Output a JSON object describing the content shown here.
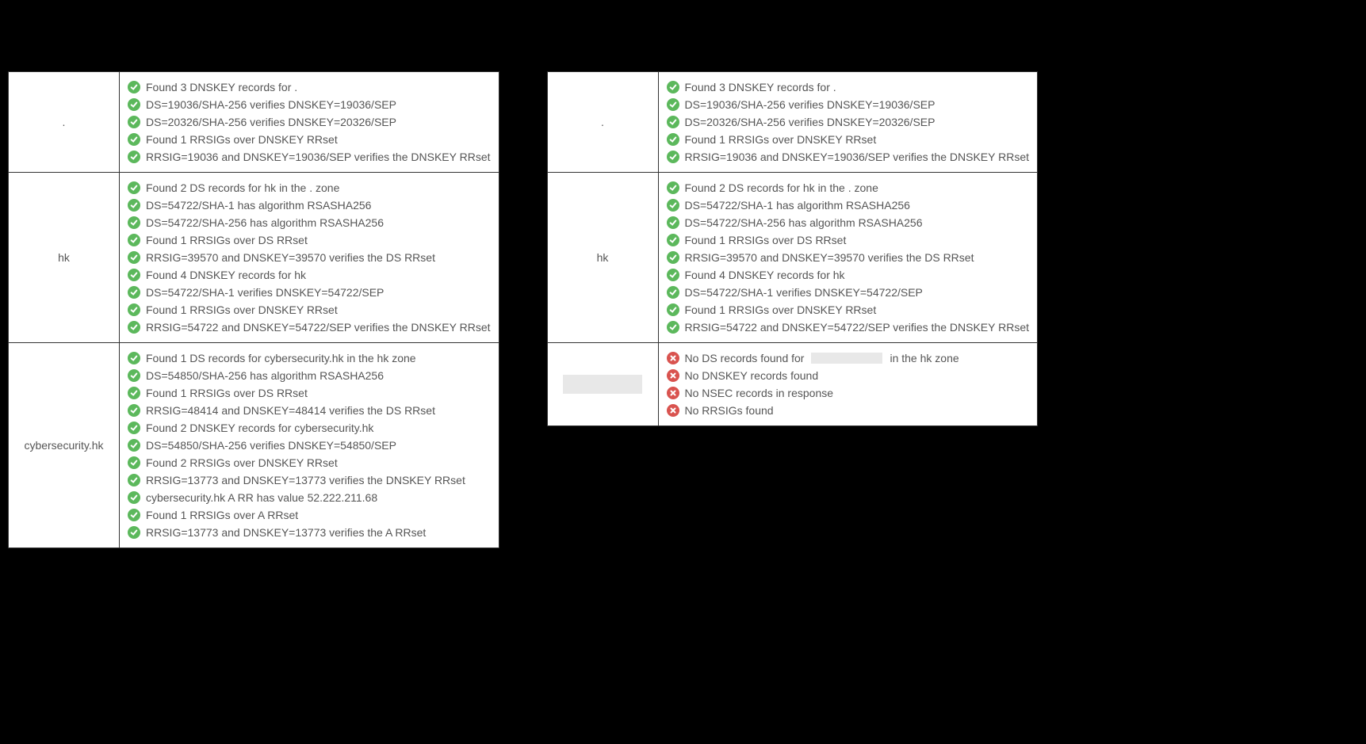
{
  "left": [
    {
      "zone": ".",
      "items": [
        {
          "status": "ok",
          "text": "Found 3 DNSKEY records for ."
        },
        {
          "status": "ok",
          "text": "DS=19036/SHA-256 verifies DNSKEY=19036/SEP"
        },
        {
          "status": "ok",
          "text": "DS=20326/SHA-256 verifies DNSKEY=20326/SEP"
        },
        {
          "status": "ok",
          "text": "Found 1 RRSIGs over DNSKEY RRset"
        },
        {
          "status": "ok",
          "text": "RRSIG=19036 and DNSKEY=19036/SEP verifies the DNSKEY RRset"
        }
      ]
    },
    {
      "zone": "hk",
      "items": [
        {
          "status": "ok",
          "text": "Found 2 DS records for hk in the . zone"
        },
        {
          "status": "ok",
          "text": "DS=54722/SHA-1 has algorithm RSASHA256"
        },
        {
          "status": "ok",
          "text": "DS=54722/SHA-256 has algorithm RSASHA256"
        },
        {
          "status": "ok",
          "text": "Found 1 RRSIGs over DS RRset"
        },
        {
          "status": "ok",
          "text": "RRSIG=39570 and DNSKEY=39570 verifies the DS RRset"
        },
        {
          "status": "ok",
          "text": "Found 4 DNSKEY records for hk"
        },
        {
          "status": "ok",
          "text": "DS=54722/SHA-1 verifies DNSKEY=54722/SEP"
        },
        {
          "status": "ok",
          "text": "Found 1 RRSIGs over DNSKEY RRset"
        },
        {
          "status": "ok",
          "text": "RRSIG=54722 and DNSKEY=54722/SEP verifies the DNSKEY RRset"
        }
      ]
    },
    {
      "zone": "cybersecurity.hk",
      "items": [
        {
          "status": "ok",
          "text": "Found 1 DS records for cybersecurity.hk in the hk zone"
        },
        {
          "status": "ok",
          "text": "DS=54850/SHA-256 has algorithm RSASHA256"
        },
        {
          "status": "ok",
          "text": "Found 1 RRSIGs over DS RRset"
        },
        {
          "status": "ok",
          "text": "RRSIG=48414 and DNSKEY=48414 verifies the DS RRset"
        },
        {
          "status": "ok",
          "text": "Found 2 DNSKEY records for cybersecurity.hk"
        },
        {
          "status": "ok",
          "text": "DS=54850/SHA-256 verifies DNSKEY=54850/SEP"
        },
        {
          "status": "ok",
          "text": "Found 2 RRSIGs over DNSKEY RRset"
        },
        {
          "status": "ok",
          "text": "RRSIG=13773 and DNSKEY=13773 verifies the DNSKEY RRset"
        },
        {
          "status": "ok",
          "text": "cybersecurity.hk A RR has value 52.222.211.68"
        },
        {
          "status": "ok",
          "text": "Found 1 RRSIGs over A RRset"
        },
        {
          "status": "ok",
          "text": "RRSIG=13773 and DNSKEY=13773 verifies the A RRset"
        }
      ]
    }
  ],
  "right": [
    {
      "zone": ".",
      "items": [
        {
          "status": "ok",
          "text": "Found 3 DNSKEY records for ."
        },
        {
          "status": "ok",
          "text": "DS=19036/SHA-256 verifies DNSKEY=19036/SEP"
        },
        {
          "status": "ok",
          "text": "DS=20326/SHA-256 verifies DNSKEY=20326/SEP"
        },
        {
          "status": "ok",
          "text": "Found 1 RRSIGs over DNSKEY RRset"
        },
        {
          "status": "ok",
          "text": "RRSIG=19036 and DNSKEY=19036/SEP verifies the DNSKEY RRset"
        }
      ]
    },
    {
      "zone": "hk",
      "items": [
        {
          "status": "ok",
          "text": "Found 2 DS records for hk in the . zone"
        },
        {
          "status": "ok",
          "text": "DS=54722/SHA-1 has algorithm RSASHA256"
        },
        {
          "status": "ok",
          "text": "DS=54722/SHA-256 has algorithm RSASHA256"
        },
        {
          "status": "ok",
          "text": "Found 1 RRSIGs over DS RRset"
        },
        {
          "status": "ok",
          "text": "RRSIG=39570 and DNSKEY=39570 verifies the DS RRset"
        },
        {
          "status": "ok",
          "text": "Found 4 DNSKEY records for hk"
        },
        {
          "status": "ok",
          "text": "DS=54722/SHA-1 verifies DNSKEY=54722/SEP"
        },
        {
          "status": "ok",
          "text": "Found 1 RRSIGs over DNSKEY RRset"
        },
        {
          "status": "ok",
          "text": "RRSIG=54722 and DNSKEY=54722/SEP verifies the DNSKEY RRset"
        }
      ]
    },
    {
      "zone_redacted": true,
      "items": [
        {
          "status": "err",
          "text_pre": "No DS records found for",
          "redacted": true,
          "text_post": "in the hk zone"
        },
        {
          "status": "err",
          "text": "No DNSKEY records found"
        },
        {
          "status": "err",
          "text": "No NSEC records in response"
        },
        {
          "status": "err",
          "text": "No RRSIGs found"
        }
      ]
    }
  ]
}
